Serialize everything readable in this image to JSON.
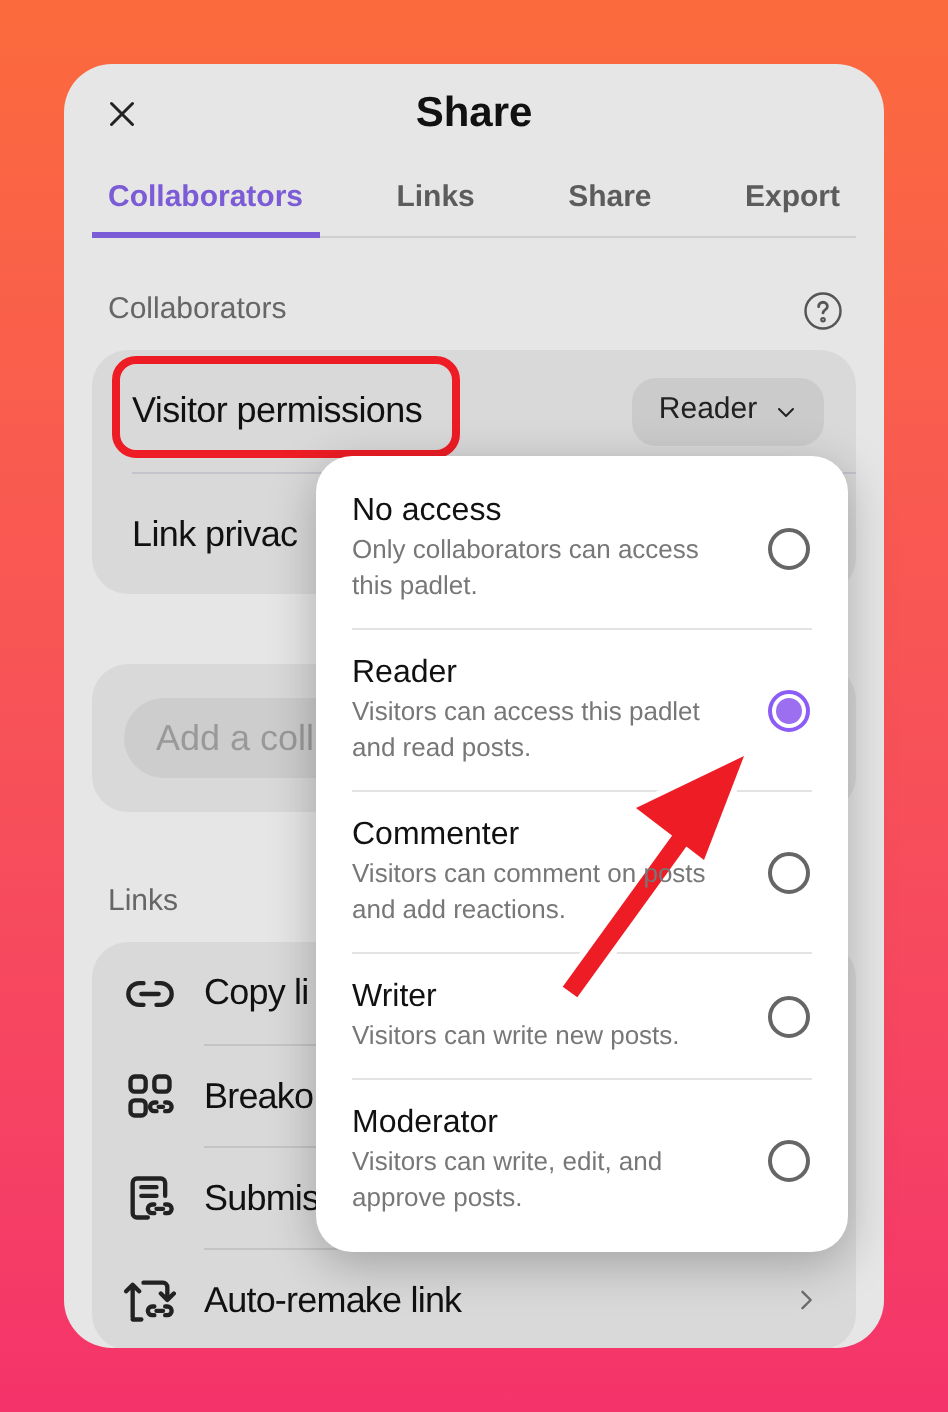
{
  "dialog": {
    "title": "Share"
  },
  "tabs": [
    {
      "label": "Collaborators",
      "selected": true
    },
    {
      "label": "Links",
      "selected": false
    },
    {
      "label": "Share",
      "selected": false
    },
    {
      "label": "Export",
      "selected": false
    }
  ],
  "collaborators_section": {
    "label": "Collaborators",
    "rows": [
      {
        "label": "Visitor permissions",
        "value": "Reader"
      },
      {
        "label": "Link privac"
      }
    ],
    "add_field": {
      "placeholder": "Add a coll"
    }
  },
  "links_section": {
    "label": "Links",
    "items": [
      {
        "label": "Copy li",
        "kind": "link"
      },
      {
        "label": "Breako",
        "kind": "grid"
      },
      {
        "label": "Submis",
        "kind": "form"
      },
      {
        "label": "Auto-remake link",
        "kind": "refresh",
        "chevron": true
      }
    ]
  },
  "permission_menu": {
    "options": [
      {
        "title": "No access",
        "description": "Only collaborators can access this padlet.",
        "selected": false
      },
      {
        "title": "Reader",
        "description": "Visitors can access this padlet and read posts.",
        "selected": true
      },
      {
        "title": "Commenter",
        "description": "Visitors can comment on posts and add reactions.",
        "selected": false
      },
      {
        "title": "Writer",
        "description": "Visitors can write new posts.",
        "selected": false
      },
      {
        "title": "Moderator",
        "description": "Visitors can write, edit, and approve posts.",
        "selected": false
      }
    ]
  }
}
